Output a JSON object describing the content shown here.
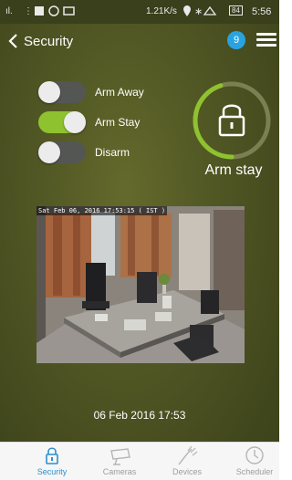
{
  "status_bar": {
    "signal": "ıl.",
    "dots": "⋮",
    "network_speed": "1.21K/s",
    "battery": "84",
    "time": "5:56"
  },
  "header": {
    "title": "Security",
    "notification_count": "9"
  },
  "modes": [
    {
      "label": "Arm Away",
      "on": false
    },
    {
      "label": "Arm Stay",
      "on": true
    },
    {
      "label": "Disarm",
      "on": false
    }
  ],
  "status": {
    "label": "Arm stay",
    "ring_fraction": 0.45,
    "accent": "#8fc22f"
  },
  "camera": {
    "timestamp": "Sat Feb 06, 2016 17:53:15 ( IST )"
  },
  "snapshot_time": "06 Feb 2016 17:53",
  "tabs": [
    {
      "label": "Security",
      "icon": "lock-icon",
      "active": true
    },
    {
      "label": "Cameras",
      "icon": "camera-icon",
      "active": false
    },
    {
      "label": "Devices",
      "icon": "devices-icon",
      "active": false
    },
    {
      "label": "Scheduler",
      "icon": "clock-icon",
      "active": false
    }
  ],
  "colors": {
    "active_tab": "#2d8fcf",
    "badge": "#29a3e0"
  }
}
